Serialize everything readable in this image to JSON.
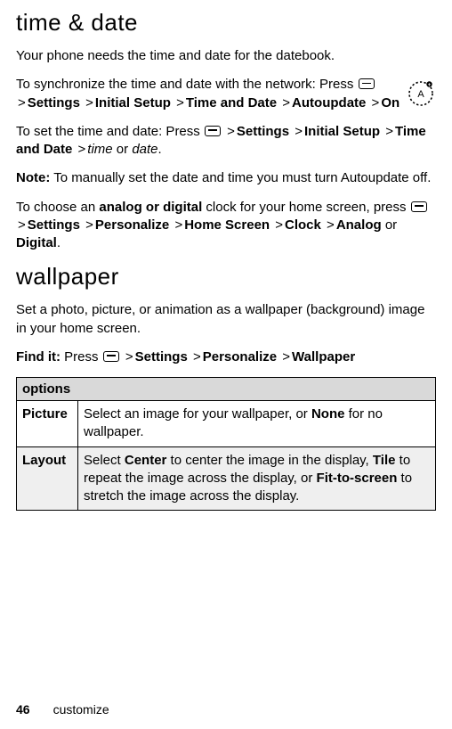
{
  "sections": {
    "timeDate": {
      "heading": "time & date",
      "intro": "Your phone needs the time and date for the datebook.",
      "sync": {
        "lead": "To synchronize the time and date with the network: Press ",
        "p1": "Settings",
        "p2": "Initial Setup",
        "p3": "Time and Date",
        "p4": "Autoupdate",
        "p5": "On"
      },
      "set": {
        "lead": "To set the time and date: Press ",
        "p1": "Settings",
        "p2": "Initial Setup",
        "p3": "Time and Date",
        "i1": "time",
        "mid": " or ",
        "i2": "date",
        "end": "."
      },
      "note": {
        "label": "Note:",
        "text": " To manually set the date and time you must turn Autoupdate off."
      },
      "clock": {
        "pre": "To choose an ",
        "strong": "analog or digital",
        "post1": " clock for your home screen, press ",
        "p1": "Settings",
        "p2": "Personalize",
        "p3": "Home Screen",
        "p4": "Clock",
        "p5": "Analog",
        "or": " or ",
        "p6": "Digital",
        "end": "."
      }
    },
    "wallpaper": {
      "heading": "wallpaper",
      "intro": "Set a photo, picture, or animation as a wallpaper (background) image in your home screen.",
      "find": {
        "label": "Find it:",
        "pre": " Press ",
        "p1": "Settings",
        "p2": "Personalize",
        "p3": "Wallpaper"
      },
      "table": {
        "header": "options",
        "r1": {
          "k": "Picture",
          "pre": "Select an image for your wallpaper, or ",
          "b1": "None",
          "post": " for no wallpaper."
        },
        "r2": {
          "k": "Layout",
          "t1": "Select ",
          "b1": "Center",
          "t2": " to center the image in the display, ",
          "b2": "Tile",
          "t3": " to repeat the image across the display, or ",
          "b3": "Fit-to-screen",
          "t4": " to stretch the image across the display."
        }
      }
    }
  },
  "footer": {
    "page": "46",
    "section": "customize"
  },
  "gt": ">"
}
